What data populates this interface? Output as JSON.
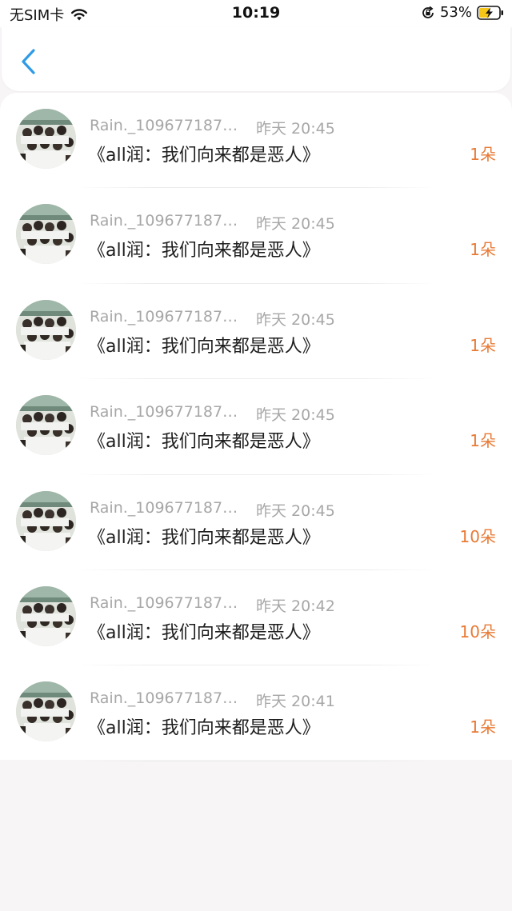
{
  "status_bar": {
    "carrier": "无SIM卡",
    "time": "10:19",
    "battery_percent": "53%",
    "icons": [
      "wifi-icon",
      "orientation-lock-icon",
      "battery-charging-icon"
    ]
  },
  "nav": {
    "back_icon": "chevron-left-icon",
    "accent_color": "#2f9be6"
  },
  "colors": {
    "count_color": "#e87a35",
    "meta_color": "#a7a7a7"
  },
  "list": {
    "items": [
      {
        "name": "Rain._1096771878...",
        "time": "昨天 20:45",
        "title": "《all润：我们向来都是恶人》",
        "count": "1朵"
      },
      {
        "name": "Rain._1096771878...",
        "time": "昨天 20:45",
        "title": "《all润：我们向来都是恶人》",
        "count": "1朵"
      },
      {
        "name": "Rain._1096771878...",
        "time": "昨天 20:45",
        "title": "《all润：我们向来都是恶人》",
        "count": "1朵"
      },
      {
        "name": "Rain._1096771878...",
        "time": "昨天 20:45",
        "title": "《all润：我们向来都是恶人》",
        "count": "1朵"
      },
      {
        "name": "Rain._1096771878...",
        "time": "昨天 20:45",
        "title": "《all润：我们向来都是恶人》",
        "count": "10朵"
      },
      {
        "name": "Rain._1096771878...",
        "time": "昨天 20:42",
        "title": "《all润：我们向来都是恶人》",
        "count": "10朵"
      },
      {
        "name": "Rain._1096771878...",
        "time": "昨天 20:41",
        "title": "《all润：我们向来都是恶人》",
        "count": "1朵"
      }
    ]
  }
}
